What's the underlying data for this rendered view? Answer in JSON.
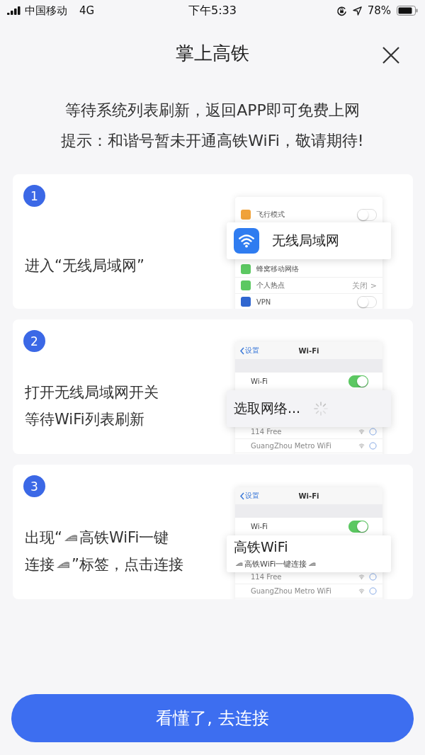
{
  "status_bar": {
    "carrier": "中国移动",
    "network": "4G",
    "time": "下午5:33",
    "battery": "78%"
  },
  "header": {
    "title": "掌上高铁"
  },
  "notice": [
    "等待系统列表刷新，返回APP即可免费上网",
    "提示：和谐号暂未开通高铁WiFi，敬请期待!"
  ],
  "steps": [
    {
      "number": "1",
      "lines": [
        [
          {
            "kind": "text",
            "text": "进入“无线局域网”"
          }
        ]
      ],
      "mock": {
        "kind": "settings",
        "rows": [
          {
            "label": "飞行模式",
            "color": "#f0a23a",
            "kind": "toggle",
            "on": false
          }
        ],
        "rows_after": [
          {
            "label": "蜂窝移动网络",
            "color": "#5cc862",
            "kind": "plain"
          },
          {
            "label": "个人热点",
            "color": "#5cc862",
            "kind": "value",
            "value": "关闭 >"
          },
          {
            "label": "VPN",
            "color": "#2f66d0",
            "kind": "toggle",
            "on": false
          }
        ],
        "popup": {
          "kind": "wifi-setting",
          "label": "无线局域网"
        }
      }
    },
    {
      "number": "2",
      "lines": [
        [
          {
            "kind": "text",
            "text": "打开无线局域网开关"
          }
        ],
        [
          {
            "kind": "text",
            "text": "等待WiFi列表刷新"
          }
        ]
      ],
      "mock": {
        "kind": "wifi",
        "back": "设置",
        "title": "Wi-Fi",
        "switch": {
          "label": "Wi-Fi",
          "on": true
        },
        "popup": {
          "kind": "loading",
          "label": "选取网络..."
        },
        "networks": [
          {
            "name": "114 Free"
          },
          {
            "name": "GuangZhou Metro WiFi"
          }
        ]
      }
    },
    {
      "number": "3",
      "lines": [
        [
          {
            "kind": "text",
            "text": "出现“"
          },
          {
            "kind": "train-icon"
          },
          {
            "kind": "text",
            "text": "高铁WiFi一键"
          }
        ],
        [
          {
            "kind": "text",
            "text": "连接"
          },
          {
            "kind": "train-icon"
          },
          {
            "kind": "text",
            "text": "”标签，点击连接"
          }
        ]
      ],
      "mock": {
        "kind": "wifi",
        "back": "设置",
        "title": "Wi-Fi",
        "switch": {
          "label": "Wi-Fi",
          "on": true
        },
        "popup": {
          "kind": "network",
          "label": "高铁WiFi",
          "subtitle": [
            {
              "kind": "train-icon"
            },
            {
              "kind": "text",
              "text": "高铁WiFi一键连接"
            },
            {
              "kind": "train-icon"
            }
          ]
        },
        "networks": [
          {
            "name": "114 Free"
          },
          {
            "name": "GuangZhou Metro WiFi"
          }
        ]
      }
    }
  ],
  "button": {
    "label": "看懂了, 去连接"
  }
}
